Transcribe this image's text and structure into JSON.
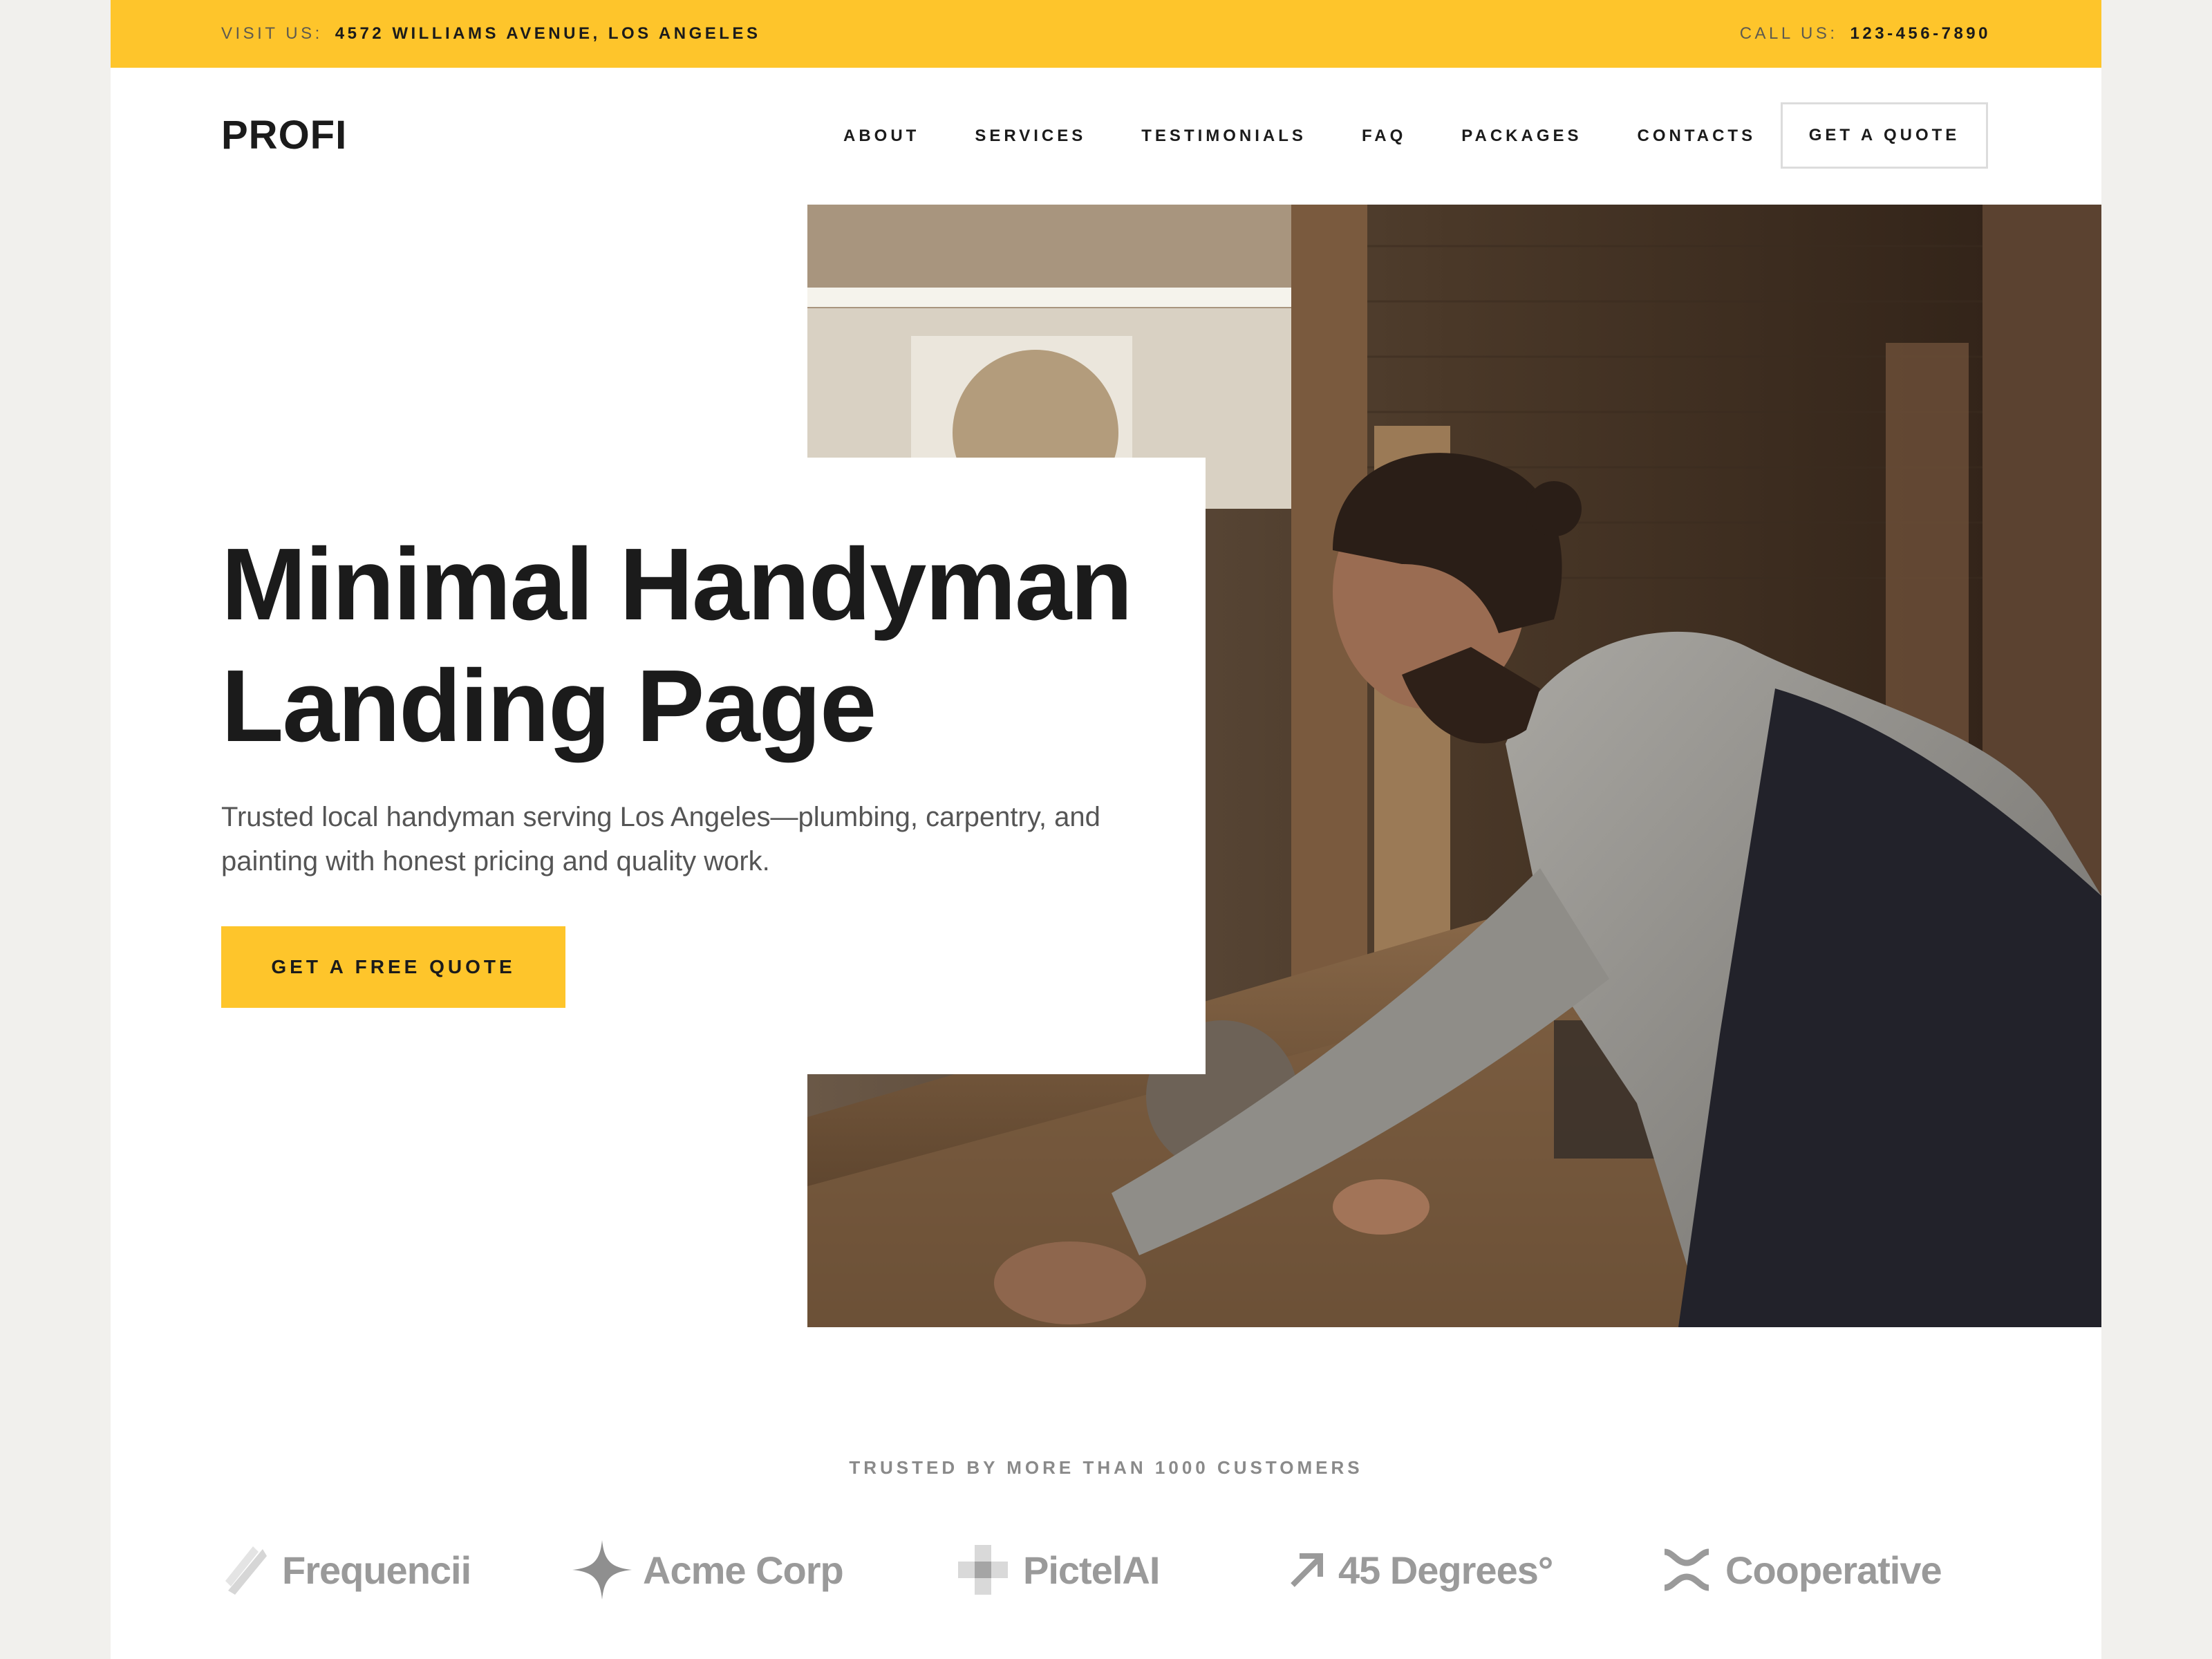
{
  "topbar": {
    "visit_label": "VISIT US:",
    "address": "4572 WILLIAMS AVENUE, LOS ANGELES",
    "call_label": "CALL US:",
    "phone": "123-456-7890"
  },
  "header": {
    "logo": "PROFI",
    "nav": [
      "ABOUT",
      "SERVICES",
      "TESTIMONIALS",
      "FAQ",
      "PACKAGES",
      "CONTACTS"
    ],
    "quote_button": "GET A QUOTE"
  },
  "hero": {
    "title_line1": "Minimal Handyman",
    "title_line2": "Landing Page",
    "subtitle": "Trusted local handyman serving Los Angeles—plumbing, carpentry, and painting with honest pricing and quality work.",
    "cta": "GET A FREE QUOTE",
    "image_alt": "Carpenter working at a table saw in a workshop"
  },
  "trusted": {
    "heading": "TRUSTED BY MORE THAN 1000 CUSTOMERS",
    "logos": [
      {
        "name": "Frequencii",
        "icon": "feather-icon"
      },
      {
        "name": "Acme Corp",
        "icon": "sparkle-icon"
      },
      {
        "name": "PictelAI",
        "icon": "pixel-icon"
      },
      {
        "name": "45 Degrees°",
        "icon": "arrow-up-right-icon"
      },
      {
        "name": "Cooperative",
        "icon": "people-icon"
      }
    ]
  },
  "colors": {
    "accent": "#fec52b",
    "text": "#1b1b1b",
    "muted": "#555555",
    "logo_gray": "#9a9a9a"
  }
}
